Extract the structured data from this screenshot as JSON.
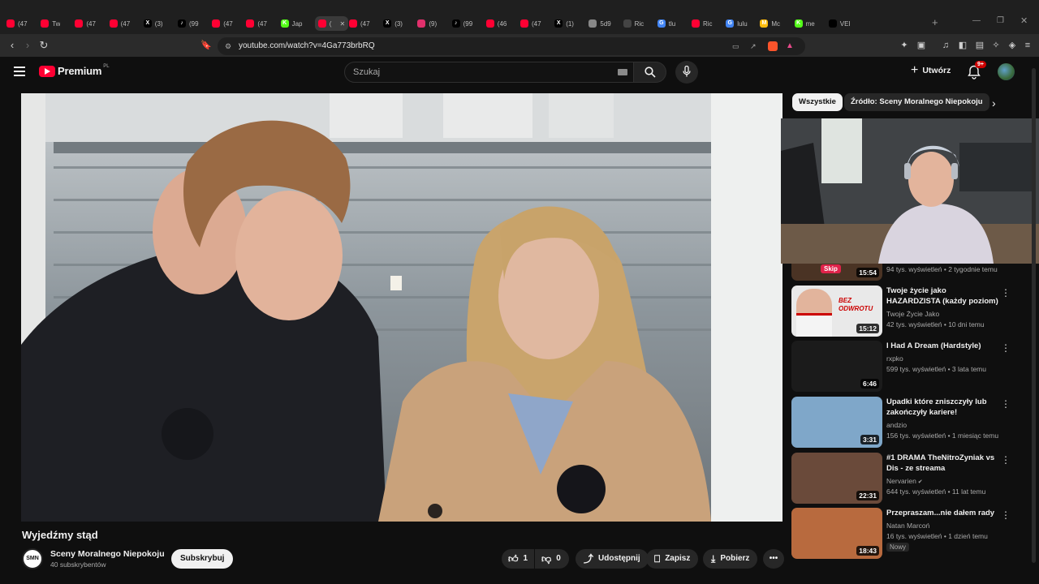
{
  "browser": {
    "tabs": [
      {
        "label": "(47",
        "color": "#ff0033",
        "active": false
      },
      {
        "label": "Tw",
        "color": "#ff0033",
        "active": false
      },
      {
        "label": "(47",
        "color": "#ff0033",
        "active": false
      },
      {
        "label": "(47",
        "color": "#ff0033",
        "active": false
      },
      {
        "label": "(3)",
        "color": "#000000",
        "glyph": "X",
        "active": false
      },
      {
        "label": "(99",
        "color": "#000000",
        "glyph": "♪",
        "active": false
      },
      {
        "label": "(47",
        "color": "#ff0033",
        "active": false
      },
      {
        "label": "(47",
        "color": "#ff0033",
        "active": false
      },
      {
        "label": "Jap",
        "color": "#53fc18",
        "glyph": "K",
        "active": false
      },
      {
        "label": "(",
        "color": "#ff0033",
        "active": true
      },
      {
        "label": "(47",
        "color": "#ff0033",
        "active": false
      },
      {
        "label": "(3)",
        "color": "#000000",
        "glyph": "X",
        "active": false
      },
      {
        "label": "(9)",
        "color": "#e1306c",
        "active": false
      },
      {
        "label": "(99",
        "color": "#000000",
        "glyph": "♪",
        "active": false
      },
      {
        "label": "(46",
        "color": "#ff0033",
        "active": false
      },
      {
        "label": "(47",
        "color": "#ff0033",
        "active": false
      },
      {
        "label": "(1)",
        "color": "#000000",
        "glyph": "X",
        "active": false
      },
      {
        "label": "5d9",
        "color": "#888888",
        "active": false
      },
      {
        "label": "Ric",
        "color": "#444444",
        "active": false
      },
      {
        "label": "tlu",
        "color": "#4285f4",
        "glyph": "G",
        "active": false
      },
      {
        "label": "Ric",
        "color": "#ff0033",
        "active": false
      },
      {
        "label": "lulu",
        "color": "#4285f4",
        "glyph": "G",
        "active": false
      },
      {
        "label": "Mc",
        "color": "#ffbc0d",
        "glyph": "M",
        "active": false
      },
      {
        "label": "me",
        "color": "#53fc18",
        "glyph": "K",
        "active": false
      },
      {
        "label": "VEI",
        "color": "#000000",
        "active": false
      }
    ],
    "url": "youtube.com/watch?v=4Ga773brbRQ"
  },
  "youtube": {
    "logo_text": "Premium",
    "logo_sup": "PL",
    "search_placeholder": "Szukaj",
    "create_label": "Utwórz",
    "notif_badge": "9+"
  },
  "video": {
    "title": "Wyjedźmy stąd",
    "channel": "Sceny Moralnego Niepokoju",
    "channel_initials": "SMN",
    "subscribers": "40 subskrybentów",
    "subscribe_label": "Subskrybuj",
    "likes": "1",
    "dislikes": "0",
    "share_label": "Udostępnij",
    "save_label": "Zapisz",
    "download_label": "Pobierz"
  },
  "sidebar": {
    "chips": [
      "Wszystkie",
      "Źródło: Sceny Moralnego Niepokoju"
    ],
    "partial_card": {
      "meta": "94 tys. wyświetleń • 2 tygodnie temu",
      "duration": "15:54",
      "thumb_label": "Skip"
    },
    "cards": [
      {
        "title": "Twoje życie jako HAZARDZISTA (każdy poziom)",
        "channel": "Twoje Życie Jako",
        "meta": "42 tys. wyświetleń • 10 dni temu",
        "duration": "15:12",
        "thumb_text": "BEZ ODWROTU",
        "thumb_color": "#e9e9e9",
        "verified": false,
        "badge": ""
      },
      {
        "title": "I Had A Dream (Hardstyle)",
        "channel": "rxpko",
        "meta": "599 tys. wyświetleń • 3 lata temu",
        "duration": "6:46",
        "thumb_text": "",
        "thumb_color": "#1b1b1b",
        "verified": false,
        "badge": ""
      },
      {
        "title": "Upadki które zniszczyły lub zakończyły kariere!",
        "channel": "andzio",
        "meta": "156 tys. wyświetleń • 1 miesiąc temu",
        "duration": "3:31",
        "thumb_text": "",
        "thumb_color": "#7fa7c9",
        "verified": false,
        "badge": ""
      },
      {
        "title": "#1 DRAMA TheNitroZyniak vs Dis - ze streama",
        "channel": "Nervarien",
        "meta": "644 tys. wyświetleń • 11 lat temu",
        "duration": "22:31",
        "thumb_text": "",
        "thumb_color": "#6a4a3a",
        "verified": true,
        "badge": ""
      },
      {
        "title": "Przepraszam...nie dałem rady",
        "channel": "Natan Marcoń",
        "meta": "16 tys. wyświetleń • 1 dzień temu",
        "duration": "18:43",
        "thumb_text": "",
        "thumb_color": "#b86a3e",
        "verified": false,
        "badge": "Nowy"
      }
    ]
  }
}
